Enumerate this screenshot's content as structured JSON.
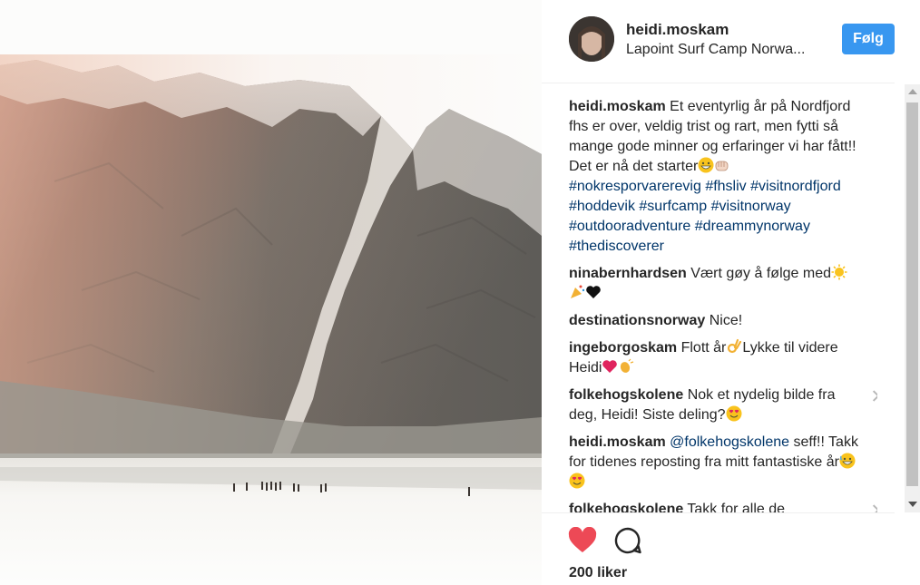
{
  "post": {
    "username": "heidi.moskam",
    "location": "Lapoint Surf Camp Norwa...",
    "follow_label": "Følg",
    "likes": "200 liker"
  },
  "caption": {
    "username": "heidi.moskam",
    "text": "Et eventyrlig år på Nordfjord fhs er over, veldig trist og rart, men fytti så mange gode minner og erfaringer vi har fått!! Det er nå det starter",
    "hashtags": [
      "#nokresporvarerevig",
      "#fhsliv",
      "#visitnordfjord",
      "#hoddevik",
      "#surfcamp",
      "#visitnorway",
      "#outdooradventure",
      "#dreammynorway",
      "#thediscoverer"
    ]
  },
  "comments": [
    {
      "username": "ninabernhardsen",
      "text": "Vært gøy å følge med"
    },
    {
      "username": "destinationsnorway",
      "text": "Nice!"
    },
    {
      "username": "ingeborgoskam",
      "text_a": "Flott år",
      "text_b": "Lykke til videre Heidi"
    },
    {
      "username": "folkehogskolene",
      "text": "Nok et nydelig bilde fra deg, Heidi! Siste deling?"
    },
    {
      "username": "heidi.moskam",
      "mention": "@folkehogskolene",
      "text": "seff!! Takk for tidenes reposting fra mitt fantastiske år"
    },
    {
      "username": "folkehogskolene",
      "text": "Takk for alle de"
    }
  ],
  "icons": {
    "like": "heart-filled-icon",
    "comment": "comment-bubble-icon",
    "close": "close-icon"
  },
  "colors": {
    "follow_button": "#3897f0",
    "like_heart": "#ed4956",
    "hashtag": "#003569"
  }
}
